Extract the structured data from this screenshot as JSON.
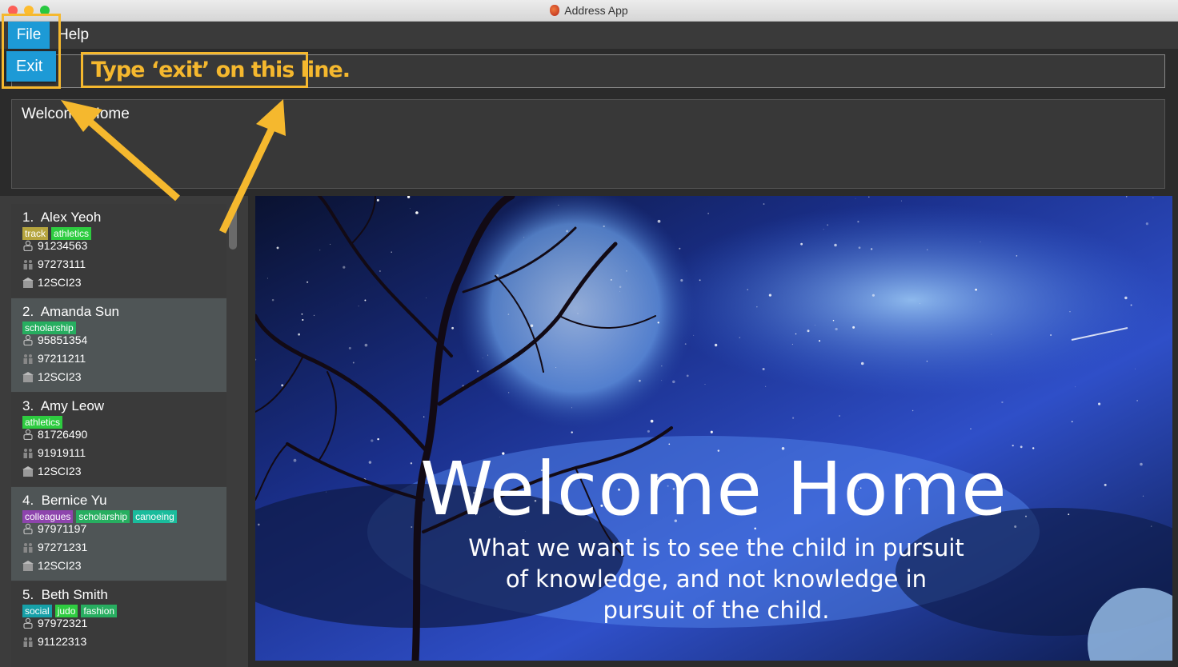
{
  "window": {
    "title": "Address App"
  },
  "menu": {
    "file": "File",
    "help": "Help",
    "exit": "Exit"
  },
  "annotation": {
    "callout": "Type ‘exit’ on this line."
  },
  "result_display": {
    "text": "Welcome Home"
  },
  "persons": [
    {
      "index": "1.",
      "name": "Alex Yeoh",
      "tags": [
        "track",
        "athletics"
      ],
      "phone": "91234563",
      "alt_phone": "97273111",
      "class": "12SCI23"
    },
    {
      "index": "2.",
      "name": "Amanda Sun",
      "tags": [
        "scholarship"
      ],
      "phone": "95851354",
      "alt_phone": "97211211",
      "class": "12SCI23"
    },
    {
      "index": "3.",
      "name": "Amy Leow",
      "tags": [
        "athletics"
      ],
      "phone": "81726490",
      "alt_phone": "91919111",
      "class": "12SCI23"
    },
    {
      "index": "4.",
      "name": "Bernice Yu",
      "tags": [
        "colleagues",
        "scholarship",
        "canoeing"
      ],
      "phone": "97971197",
      "alt_phone": "97271231",
      "class": "12SCI23"
    },
    {
      "index": "5.",
      "name": "Beth Smith",
      "tags": [
        "social",
        "judo",
        "fashion"
      ],
      "phone": "97972321",
      "alt_phone": "91122313",
      "class": ""
    }
  ],
  "tag_colors": {
    "track": "#b5a43e",
    "athletics": "#2ecc40",
    "scholarship": "#27ae60",
    "colleagues": "#8e44ad",
    "canoeing": "#1abc9c",
    "social": "#16a0a8",
    "judo": "#2ecc40",
    "fashion": "#27ae60"
  },
  "welcome": {
    "title": "Welcome Home",
    "quote_lines": [
      "What we want is to see the child in pursuit",
      "of knowledge, and not knowledge in",
      "pursuit of the child."
    ]
  },
  "colors": {
    "accent": "#1d9ad6",
    "highlight": "#f5b82e"
  },
  "icons": {
    "phone": "person-phone-icon",
    "alt_phone": "family-icon",
    "class": "class-icon"
  }
}
